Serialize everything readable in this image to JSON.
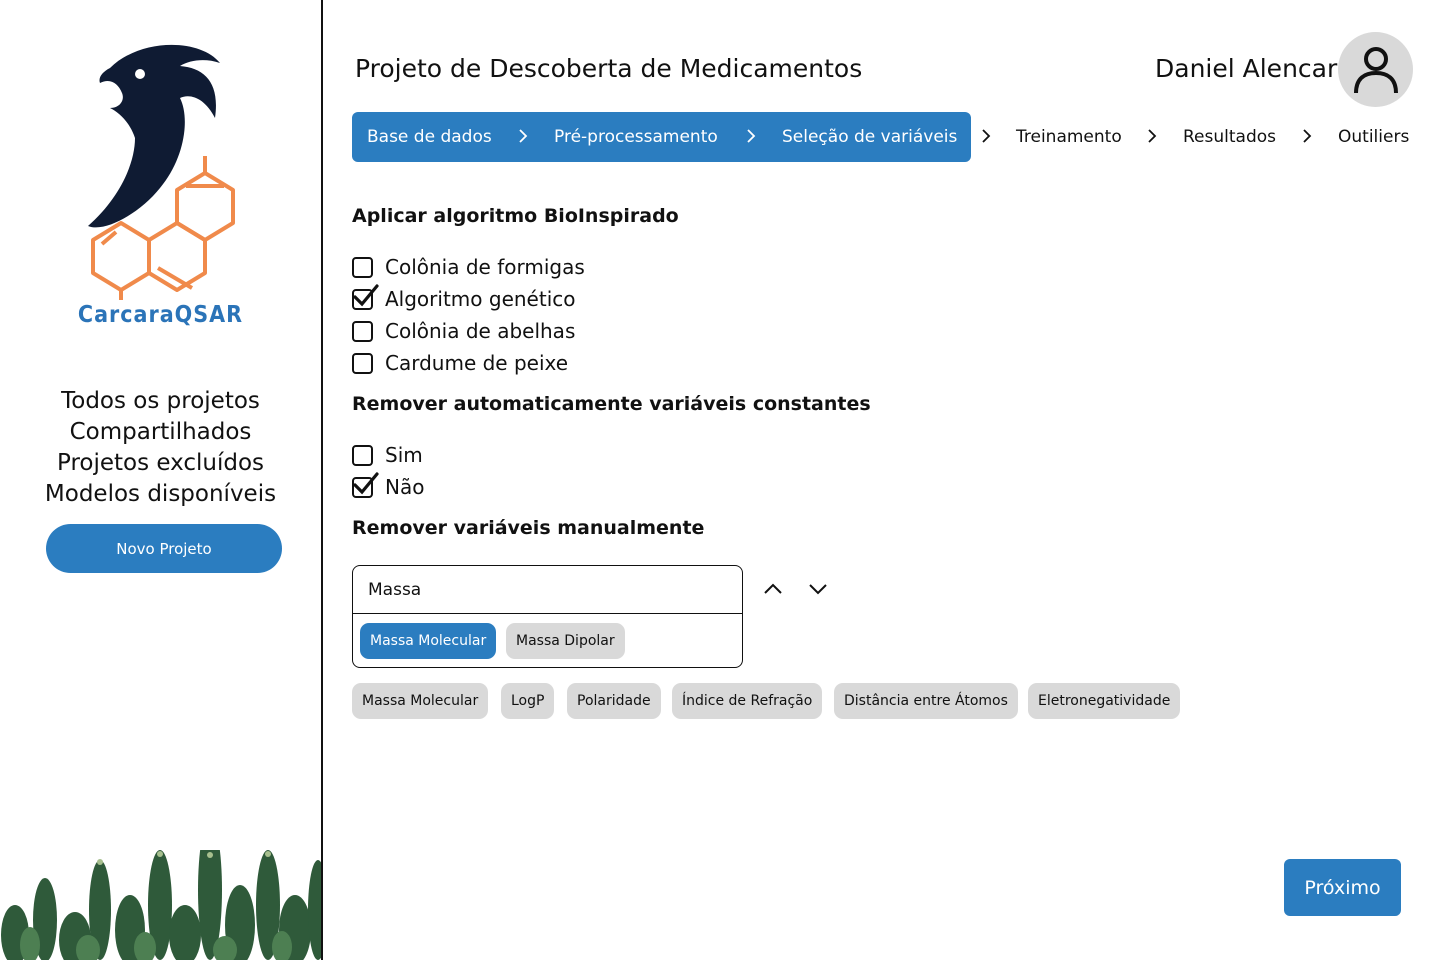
{
  "brand": {
    "name": "CarcaraQSAR",
    "accent": "#2b7dc0",
    "orange": "#f08a4b"
  },
  "sidebar": {
    "nav": [
      "Todos os projetos",
      "Compartilhados",
      "Projetos excluídos",
      "Modelos disponíveis"
    ],
    "new_project_label": "Novo Projeto"
  },
  "header": {
    "project_title": "Projeto de Descoberta de Medicamentos",
    "user_name": "Daniel Alencar",
    "avatar_icon": "user-icon"
  },
  "stepper": {
    "steps": [
      "Base de dados",
      "Pré-processamento",
      "Seleção de variáveis",
      "Treinamento",
      "Resultados",
      "Outiliers"
    ],
    "completed_through": "Seleção de variáveis"
  },
  "bio_algorithms": {
    "title": "Aplicar algoritmo BioInspirado",
    "options": [
      {
        "label": "Colônia de formigas",
        "checked": false
      },
      {
        "label": "Algoritmo genético",
        "checked": true
      },
      {
        "label": "Colônia de abelhas",
        "checked": false
      },
      {
        "label": "Cardume de peixe",
        "checked": false
      }
    ]
  },
  "remove_constants": {
    "title": "Remover automaticamente variáveis constantes",
    "options": [
      {
        "label": "Sim",
        "checked": false
      },
      {
        "label": "Não",
        "checked": true
      }
    ]
  },
  "manual_removal": {
    "title": "Remover variáveis manualmente",
    "search_value": "Massa",
    "suggestions": [
      {
        "label": "Massa Molecular",
        "selected": true
      },
      {
        "label": "Massa Dipolar",
        "selected": false
      }
    ],
    "chips": [
      "Massa Molecular",
      "LogP",
      "Polaridade",
      "Índice de Refração",
      "Distância entre Átomos",
      "Eletronegatividade"
    ]
  },
  "footer": {
    "next_label": "Próximo"
  }
}
